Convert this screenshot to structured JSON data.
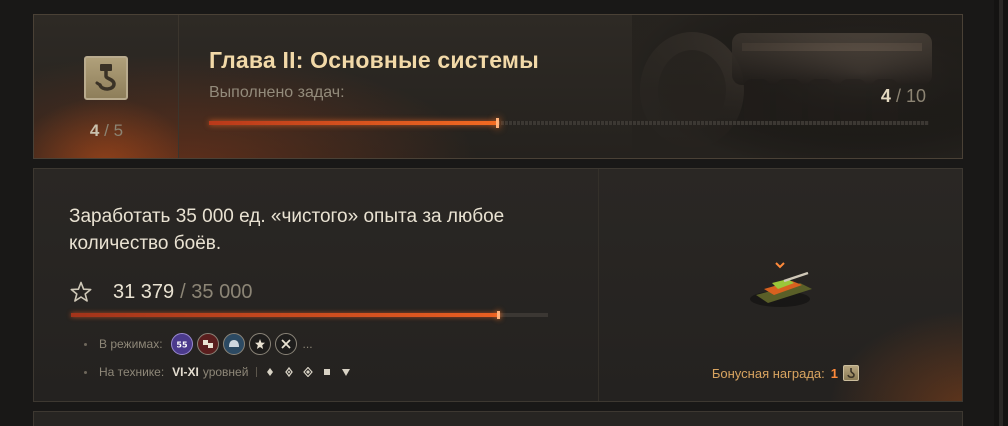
{
  "chapter": {
    "title": "Глава II: Основные системы",
    "subtitle": "Выполнено задач:",
    "emblem_icon": "hook-icon",
    "small_progress_done": "4",
    "small_progress_sep": "/",
    "small_progress_total": "5",
    "tasks_done": "4",
    "tasks_sep": "/",
    "tasks_total": "10",
    "progress_fraction": 0.4,
    "accent_color": "#f26a22"
  },
  "task": {
    "description": "Заработать 35 000 ед. «чистого» опыта за любое количество боёв.",
    "progress_current": "31 379",
    "progress_total": "/ 35 000",
    "progress_value": 31379,
    "progress_max": 35000,
    "modes_label": "В режимах:",
    "modes": [
      "mode-55-icon",
      "mode-dice-icon",
      "mode-helmet-icon",
      "mode-star-icon",
      "mode-swords-icon"
    ],
    "modes_more": "...",
    "vehicles_label": "На технике:",
    "tier_range": "VI-XI",
    "tier_word": "уровней",
    "vehicle_classes": [
      "light-tank-icon",
      "medium-tank-icon",
      "heavy-tank-icon",
      "spg-icon",
      "td-icon"
    ],
    "bonus_label": "Бонусная награда:",
    "bonus_count": "1",
    "bonus_icon": "hook-icon"
  }
}
